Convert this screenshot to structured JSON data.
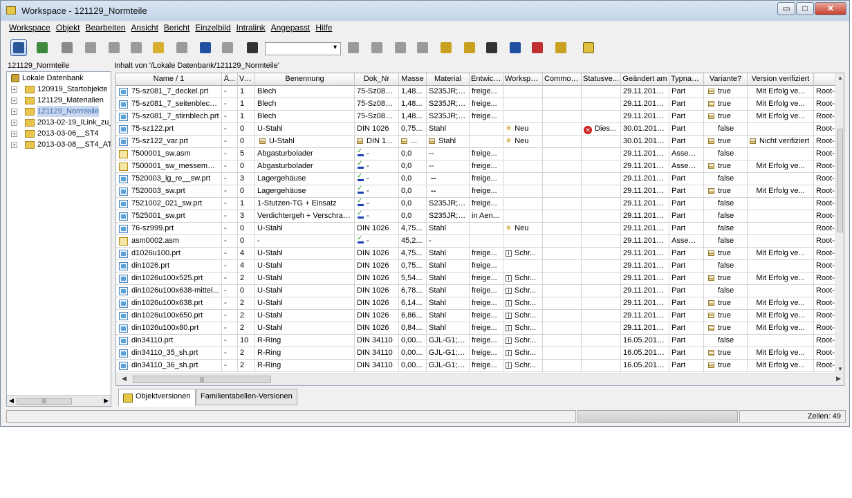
{
  "window": {
    "title": "Workspace - 121129_Normteile",
    "min_symbol": "▭",
    "max_symbol": "□",
    "close_symbol": "✕"
  },
  "menu": [
    "Workspace",
    "Objekt",
    "Bearbeiten",
    "Ansicht",
    "Bericht",
    "Einzelbild",
    "Intralink",
    "Angepasst",
    "Hilfe"
  ],
  "toolbar": {
    "buttons": [
      {
        "icon": "refresh-icon",
        "color": "#2b5797"
      },
      {
        "icon": "sync-icon",
        "color": "#3d8a3d"
      },
      {
        "icon": "checkout-icon",
        "color": "#8a8a8a"
      },
      {
        "icon": "part-icon",
        "color": "#9a9a9a"
      },
      {
        "icon": "info-icon",
        "color": "#9a9a9a"
      },
      {
        "icon": "replace-icon",
        "color": "#9a9a9a"
      },
      {
        "icon": "new-icon",
        "color": "#d8b030"
      },
      {
        "icon": "copy-icon",
        "color": "#9a9a9a"
      },
      {
        "icon": "undo-icon",
        "color": "#1f4fa0"
      },
      {
        "icon": "redo-icon",
        "color": "#9a9a9a"
      },
      {
        "icon": "table-icon",
        "color": "#333333"
      },
      {
        "icon": "workspace-icon",
        "color": "#9a9a9a"
      },
      {
        "icon": "import-icon",
        "color": "#9a9a9a"
      },
      {
        "icon": "export-icon",
        "color": "#9a9a9a"
      },
      {
        "icon": "table2-icon",
        "color": "#9a9a9a"
      },
      {
        "icon": "notes-icon",
        "color": "#c9a020"
      },
      {
        "icon": "tree-icon",
        "color": "#c9a020"
      },
      {
        "icon": "search-icon",
        "color": "#333333"
      },
      {
        "icon": "check-icon",
        "color": "#1f4fa0"
      },
      {
        "icon": "update-icon",
        "color": "#c03030"
      },
      {
        "icon": "key-icon",
        "color": "#c9a020"
      },
      {
        "icon": "help-icon",
        "color": "#e0c040"
      }
    ],
    "combo_value": "",
    "combo_arrow": "▼"
  },
  "tree": {
    "header": "121129_Normteile",
    "root": "Lokale Datenbank",
    "items": [
      "120919_Startobjekte",
      "121129_Materialien",
      "121129_Normteile",
      "2013-02-19_ILink_zu_",
      "2013-03-06__ST4",
      "2013-03-08__ST4_ATI"
    ],
    "expand_symbol": "+",
    "scroll_left": "◀",
    "scroll_right": "▶",
    "scroll_thumb": "|||"
  },
  "path": "Inhalt von '/Lokale Datenbank/121129_Normteile'",
  "table": {
    "headers": [
      "Name / 1",
      "Ä...",
      "Ve...",
      "Benennung",
      "Dok_Nr",
      "Masse",
      "Material",
      "Entwick...",
      "Workspa...",
      "Common...",
      "Statusve...",
      "Geändert am",
      "Typname",
      "Variante?",
      "Version verifiziert",
      ""
    ],
    "rows": [
      {
        "name": "75-sz081_7_deckel.prt",
        "icon": "prt",
        "ae": "-",
        "ve": "1",
        "benennung": "Blech",
        "dok": "75-Sz081_7",
        "masse": "1,48...",
        "material": "S235JR;1...",
        "entw": "freige...",
        "ws": "",
        "common": "",
        "status": "",
        "geaendert": "29.11.2012...",
        "typ": "Part",
        "var": "true",
        "vv": "Mit Erfolg ve...",
        "last": "Root-"
      },
      {
        "name": "75-sz081_7_seitenblech...",
        "icon": "prt",
        "ae": "-",
        "ve": "1",
        "benennung": "Blech",
        "dok": "75-Sz081_7",
        "masse": "1,48...",
        "material": "S235JR;1...",
        "entw": "freige...",
        "ws": "",
        "common": "",
        "status": "",
        "geaendert": "29.11.2012...",
        "typ": "Part",
        "var": "true",
        "vv": "Mit Erfolg ve...",
        "last": "Root-"
      },
      {
        "name": "75-sz081_7_stirnblech.prt",
        "icon": "prt",
        "ae": "-",
        "ve": "1",
        "benennung": "Blech",
        "dok": "75-Sz081_7",
        "masse": "1,48...",
        "material": "S235JR;1...",
        "entw": "freige...",
        "ws": "",
        "common": "",
        "status": "",
        "geaendert": "29.11.2012...",
        "typ": "Part",
        "var": "true",
        "vv": "Mit Erfolg ve...",
        "last": "Root-"
      },
      {
        "name": "75-sz122.prt",
        "icon": "prt",
        "ae": "-",
        "ve": "0",
        "benennung": "U-Stahl",
        "dok": "DIN 1026",
        "masse": "0,75...",
        "material": "Stahl",
        "entw": "",
        "ws": "Neu",
        "common": "",
        "status": "Dies...",
        "geaendert": "30.01.2013...",
        "typ": "Part",
        "var": "false",
        "vv": "",
        "last": "Root-"
      },
      {
        "name": "75-sz122_var.prt",
        "icon": "prt",
        "ae": "-",
        "ve": "0",
        "benennung": "U-Stahl",
        "dok": "DIN 1...",
        "masse": "...",
        "material": "Stahl",
        "entw": "",
        "ws": "Neu",
        "common": "",
        "status": "",
        "geaendert": "30.01.2013...",
        "typ": "Part",
        "var": "true",
        "vv": "Nicht verifiziert",
        "last": "Root-"
      },
      {
        "name": "7500001_sw.asm",
        "icon": "asm",
        "ae": "-",
        "ve": "5",
        "benennung": "Abgasturbolader",
        "dok": "-",
        "masse": "0,0",
        "material": "--",
        "entw": "freige...",
        "ws": "",
        "common": "",
        "status": "",
        "geaendert": "29.11.2012...",
        "typ": "Assembly",
        "var": "false",
        "vv": "",
        "last": "Root-"
      },
      {
        "name": "7500001_sw_messemod...",
        "icon": "asm",
        "ae": "-",
        "ve": "0",
        "benennung": "Abgasturbolader",
        "dok": "-",
        "masse": "0,0",
        "material": "--",
        "entw": "freige...",
        "ws": "",
        "common": "",
        "status": "",
        "geaendert": "29.11.2012...",
        "typ": "Assembly",
        "var": "true",
        "vv": "Mit Erfolg ve...",
        "last": "Root-"
      },
      {
        "name": "7520003_lg_re__sw.prt",
        "icon": "prt",
        "ae": "-",
        "ve": "3",
        "benennung": "Lagergehäuse",
        "dok": "-",
        "masse": "0,0",
        "material": "--",
        "entw": "freige...",
        "ws": "",
        "common": "",
        "status": "",
        "geaendert": "29.11.2012...",
        "typ": "Part",
        "var": "false",
        "vv": "",
        "last": "Root-"
      },
      {
        "name": "7520003_sw.prt",
        "icon": "prt",
        "ae": "-",
        "ve": "0",
        "benennung": "Lagergehäuse",
        "dok": "-",
        "masse": "0,0",
        "material": "--",
        "entw": "freige...",
        "ws": "",
        "common": "",
        "status": "",
        "geaendert": "29.11.2012...",
        "typ": "Part",
        "var": "true",
        "vv": "Mit Erfolg ve...",
        "last": "Root-"
      },
      {
        "name": "7521002_021_sw.prt",
        "icon": "prt",
        "ae": "-",
        "ve": "1",
        "benennung": "1-Stutzen-TG + Einsatz",
        "dok": "-",
        "masse": "0,0",
        "material": "S235JR;1...",
        "entw": "freige...",
        "ws": "",
        "common": "",
        "status": "",
        "geaendert": "29.11.2012...",
        "typ": "Part",
        "var": "false",
        "vv": "",
        "last": "Root-"
      },
      {
        "name": "7525001_sw.prt",
        "icon": "prt",
        "ae": "-",
        "ve": "3",
        "benennung": "Verdichtergeh + Verschrau...",
        "dok": "-",
        "masse": "0,0",
        "material": "S235JR;1...",
        "entw": "in Aen...",
        "ws": "",
        "common": "",
        "status": "",
        "geaendert": "29.11.2012...",
        "typ": "Part",
        "var": "false",
        "vv": "",
        "last": "Root-"
      },
      {
        "name": "76-sz999.prt",
        "icon": "prt",
        "ae": "-",
        "ve": "0",
        "benennung": "U-Stahl",
        "dok": "DIN 1026",
        "masse": "4,75...",
        "material": "Stahl",
        "entw": "",
        "ws": "Neu",
        "common": "",
        "status": "",
        "geaendert": "29.11.2012...",
        "typ": "Part",
        "var": "false",
        "vv": "",
        "last": "Root-"
      },
      {
        "name": "asm0002.asm",
        "icon": "asm",
        "ae": "-",
        "ve": "0",
        "benennung": "-",
        "dok": "-",
        "masse": "45,2...",
        "material": "-",
        "entw": "",
        "ws": "",
        "common": "",
        "status": "",
        "geaendert": "29.11.2012...",
        "typ": "Assembly",
        "var": "false",
        "vv": "",
        "last": "Root-"
      },
      {
        "name": "d1026u100.prt",
        "icon": "prt",
        "ae": "-",
        "ve": "4",
        "benennung": "U-Stahl",
        "dok": "DIN 1026",
        "masse": "4,75...",
        "material": "Stahl",
        "entw": "freige...",
        "ws": "Schr...",
        "common": "",
        "status": "",
        "geaendert": "29.11.2012...",
        "typ": "Part",
        "var": "true",
        "vv": "Mit Erfolg ve...",
        "last": "Root-"
      },
      {
        "name": "din1026.prt",
        "icon": "prt",
        "ae": "-",
        "ve": "4",
        "benennung": "U-Stahl",
        "dok": "DIN 1026",
        "masse": "0,75...",
        "material": "Stahl",
        "entw": "freige...",
        "ws": "",
        "common": "",
        "status": "",
        "geaendert": "29.11.2012...",
        "typ": "Part",
        "var": "false",
        "vv": "",
        "last": "Root-"
      },
      {
        "name": "din1026u100x525.prt",
        "icon": "prt",
        "ae": "-",
        "ve": "2",
        "benennung": "U-Stahl",
        "dok": "DIN 1026",
        "masse": "5,54...",
        "material": "Stahl",
        "entw": "freige...",
        "ws": "Schr...",
        "common": "",
        "status": "",
        "geaendert": "29.11.2012...",
        "typ": "Part",
        "var": "true",
        "vv": "Mit Erfolg ve...",
        "last": "Root-"
      },
      {
        "name": "din1026u100x638-mittel...",
        "icon": "prt",
        "ae": "-",
        "ve": "0",
        "benennung": "U-Stahl",
        "dok": "DIN 1026",
        "masse": "6,78...",
        "material": "Stahl",
        "entw": "freige...",
        "ws": "Schr...",
        "common": "",
        "status": "",
        "geaendert": "29.11.2012...",
        "typ": "Part",
        "var": "false",
        "vv": "",
        "last": "Root-"
      },
      {
        "name": "din1026u100x638.prt",
        "icon": "prt",
        "ae": "-",
        "ve": "2",
        "benennung": "U-Stahl",
        "dok": "DIN 1026",
        "masse": "6,14...",
        "material": "Stahl",
        "entw": "freige...",
        "ws": "Schr...",
        "common": "",
        "status": "",
        "geaendert": "29.11.2012...",
        "typ": "Part",
        "var": "true",
        "vv": "Mit Erfolg ve...",
        "last": "Root-"
      },
      {
        "name": "din1026u100x650.prt",
        "icon": "prt",
        "ae": "-",
        "ve": "2",
        "benennung": "U-Stahl",
        "dok": "DIN 1026",
        "masse": "6,86...",
        "material": "Stahl",
        "entw": "freige...",
        "ws": "Schr...",
        "common": "",
        "status": "",
        "geaendert": "29.11.2012...",
        "typ": "Part",
        "var": "true",
        "vv": "Mit Erfolg ve...",
        "last": "Root-"
      },
      {
        "name": "din1026u100x80.prt",
        "icon": "prt",
        "ae": "-",
        "ve": "2",
        "benennung": "U-Stahl",
        "dok": "DIN 1026",
        "masse": "0,84...",
        "material": "Stahl",
        "entw": "freige...",
        "ws": "Schr...",
        "common": "",
        "status": "",
        "geaendert": "29.11.2012...",
        "typ": "Part",
        "var": "true",
        "vv": "Mit Erfolg ve...",
        "last": "Root-"
      },
      {
        "name": "din34110.prt",
        "icon": "prt",
        "ae": "-",
        "ve": "10",
        "benennung": "R-Ring",
        "dok": "DIN 34110",
        "masse": "0,00...",
        "material": "GJL-G1;K...",
        "entw": "freige...",
        "ws": "Schr...",
        "common": "",
        "status": "",
        "geaendert": "16.05.2013...",
        "typ": "Part",
        "var": "false",
        "vv": "",
        "last": "Root-"
      },
      {
        "name": "din34110_35_sh.prt",
        "icon": "prt",
        "ae": "-",
        "ve": "2",
        "benennung": "R-Ring",
        "dok": "DIN 34110",
        "masse": "0,00...",
        "material": "GJL-G1;K...",
        "entw": "freige...",
        "ws": "Schr...",
        "common": "",
        "status": "",
        "geaendert": "16.05.2013...",
        "typ": "Part",
        "var": "true",
        "vv": "Mit Erfolg ve...",
        "last": "Root-"
      },
      {
        "name": "din34110_36_sh.prt",
        "icon": "prt",
        "ae": "-",
        "ve": "2",
        "benennung": "R-Ring",
        "dok": "DIN 34110",
        "masse": "0,00...",
        "material": "GJL-G1;K...",
        "entw": "freige...",
        "ws": "Schr...",
        "common": "",
        "status": "",
        "geaendert": "16.05.2013...",
        "typ": "Part",
        "var": "true",
        "vv": "Mit Erfolg ve...",
        "last": "Root-"
      }
    ],
    "scroll_up": "▲",
    "scroll_down": "▼",
    "scroll_left": "◀",
    "scroll_right": "▶",
    "scroll_thumb": "|||"
  },
  "tabs": [
    "Objektversionen",
    "Familientabellen-Versionen"
  ],
  "status": {
    "message": "",
    "rows": "Zeilen: 49"
  },
  "colors": {
    "selection": "#c8d8ee",
    "title_bar": "#c3d4e9",
    "close_button": "#c7402b"
  }
}
